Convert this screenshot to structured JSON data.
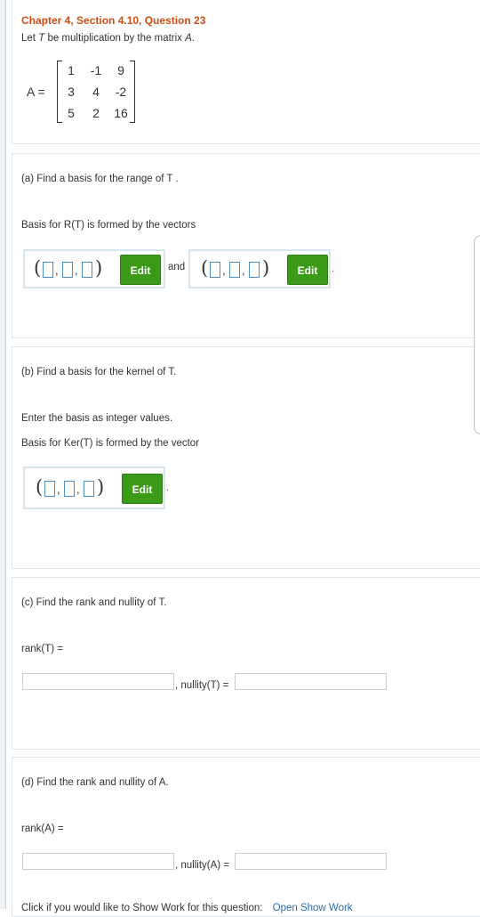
{
  "question": {
    "title": "Chapter 4, Section 4.10, Question 23",
    "intro_let": "Let",
    "intro_T": "T",
    "intro_rest": "be multiplication by the matrix",
    "intro_A": "A",
    "intro_end": ".",
    "matrix_label": "A =",
    "matrix": [
      [
        "1",
        "-1",
        "9"
      ],
      [
        "3",
        "4",
        "-2"
      ],
      [
        "5",
        "2",
        "16"
      ]
    ]
  },
  "part_a": {
    "prompt": "(a) Find a basis for the range of T .",
    "instruction": "Basis for R(T) is formed by the vectors",
    "edit_label_1": "Edit",
    "and_label": "and",
    "edit_label_2": "Edit",
    "period": "."
  },
  "part_b": {
    "prompt": "(b) Find a basis for the kernel of T.",
    "note": "Enter the basis as integer values.",
    "instruction": "Basis for Ker(T) is formed by the vector",
    "edit_label": "Edit",
    "period": "."
  },
  "part_c": {
    "prompt": "(c) Find the rank and nullity of T.",
    "rank_label": "rank(T) =",
    "nullity_label": ", nullity(T) ="
  },
  "part_d": {
    "prompt": "(d) Find the rank and nullity of A.",
    "rank_label": "rank(A) =",
    "nullity_label": ", nullity(A) ="
  },
  "footer": {
    "text": "Click if you would like to Show Work for this question:",
    "link": "Open Show Work"
  }
}
